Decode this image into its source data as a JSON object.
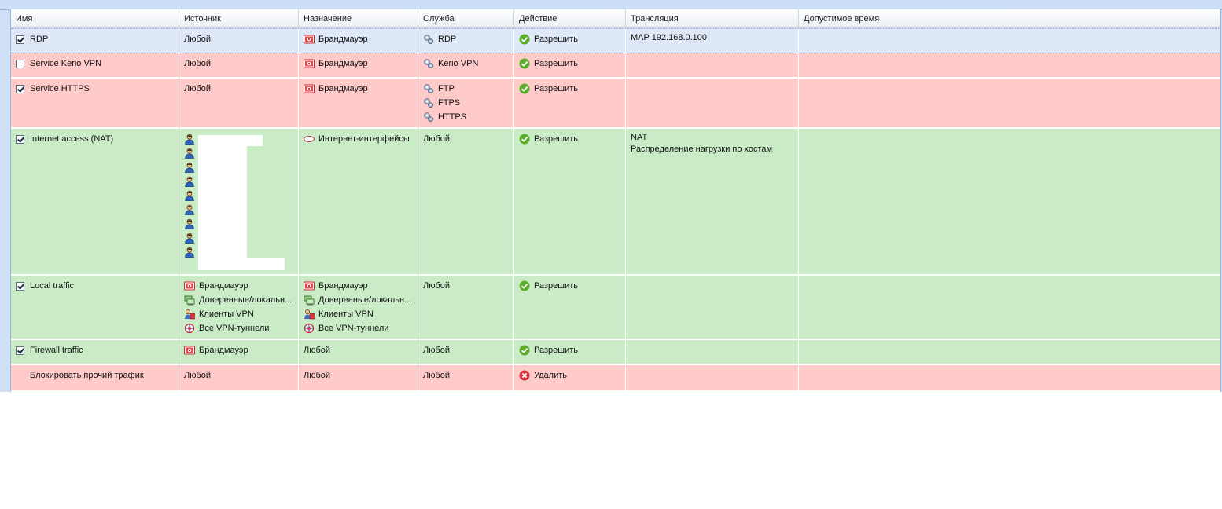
{
  "colors": {
    "selected_row": "#dfe8f6",
    "blocked_row": "#ffcaca",
    "allowed_row": "#c9ecc7",
    "allow_icon": "#5aac2a",
    "deny_icon": "#d9303a"
  },
  "columns": [
    {
      "label": "Имя"
    },
    {
      "label": "Источник"
    },
    {
      "label": "Назначение"
    },
    {
      "label": "Служба"
    },
    {
      "label": "Действие"
    },
    {
      "label": "Трансляция"
    },
    {
      "label": "Допустимое время"
    }
  ],
  "rows": [
    {
      "name": "RDP",
      "checkbox": "checked",
      "state": "selected",
      "source": [
        {
          "icon": "none",
          "text": "Любой"
        }
      ],
      "destination": [
        {
          "icon": "firewall-icon",
          "text": "Брандмауэр"
        }
      ],
      "service": [
        {
          "icon": "gears-icon",
          "text": "RDP"
        }
      ],
      "action": {
        "icon": "allow-icon",
        "text": "Разрешить"
      },
      "translation": [
        "MAP 192.168.0.100"
      ],
      "time": ""
    },
    {
      "name": "Service Kerio VPN",
      "checkbox": "unchecked",
      "state": "blocked",
      "source": [
        {
          "icon": "none",
          "text": "Любой"
        }
      ],
      "destination": [
        {
          "icon": "firewall-icon",
          "text": "Брандмауэр"
        }
      ],
      "service": [
        {
          "icon": "gears-icon",
          "text": "Kerio VPN"
        }
      ],
      "action": {
        "icon": "allow-icon",
        "text": "Разрешить"
      },
      "translation": [],
      "time": ""
    },
    {
      "name": "Service HTTPS",
      "checkbox": "checked",
      "state": "blocked",
      "source": [
        {
          "icon": "none",
          "text": "Любой"
        }
      ],
      "destination": [
        {
          "icon": "firewall-icon",
          "text": "Брандмауэр"
        }
      ],
      "service": [
        {
          "icon": "gears-icon",
          "text": "FTP"
        },
        {
          "icon": "gears-icon",
          "text": "FTPS"
        },
        {
          "icon": "gears-icon",
          "text": "HTTPS"
        }
      ],
      "action": {
        "icon": "allow-icon",
        "text": "Разрешить"
      },
      "translation": [],
      "time": ""
    },
    {
      "name": "Internet access (NAT)",
      "checkbox": "checked",
      "state": "allowed",
      "source": [
        {
          "icon": "user-icon",
          "text": ""
        },
        {
          "icon": "user-icon",
          "text": ""
        },
        {
          "icon": "user-icon",
          "text": ""
        },
        {
          "icon": "user-icon",
          "text": ""
        },
        {
          "icon": "user-icon",
          "text": ""
        },
        {
          "icon": "user-icon",
          "text": ""
        },
        {
          "icon": "user-icon",
          "text": ""
        },
        {
          "icon": "user-icon",
          "text": ""
        },
        {
          "icon": "user-icon",
          "text": ""
        }
      ],
      "destination": [
        {
          "icon": "interface-icon",
          "text": "Интернет-интерфейсы"
        }
      ],
      "service": [
        {
          "icon": "none",
          "text": "Любой"
        }
      ],
      "action": {
        "icon": "allow-icon",
        "text": "Разрешить"
      },
      "translation": [
        "NAT",
        "Распределение нагрузки по хостам"
      ],
      "time": ""
    },
    {
      "name": "Local traffic",
      "checkbox": "checked",
      "state": "allowed",
      "source": [
        {
          "icon": "firewall-icon",
          "text": "Брандмауэр"
        },
        {
          "icon": "network-icon",
          "text": "Доверенные/локальн..."
        },
        {
          "icon": "vpn-clients-icon",
          "text": "Клиенты VPN"
        },
        {
          "icon": "vpn-tunnels-icon",
          "text": "Все VPN-туннели"
        }
      ],
      "destination": [
        {
          "icon": "firewall-icon",
          "text": "Брандмауэр"
        },
        {
          "icon": "network-icon",
          "text": "Доверенные/локальн..."
        },
        {
          "icon": "vpn-clients-icon",
          "text": "Клиенты VPN"
        },
        {
          "icon": "vpn-tunnels-icon",
          "text": "Все VPN-туннели"
        }
      ],
      "service": [
        {
          "icon": "none",
          "text": "Любой"
        }
      ],
      "action": {
        "icon": "allow-icon",
        "text": "Разрешить"
      },
      "translation": [],
      "time": ""
    },
    {
      "name": "Firewall traffic",
      "checkbox": "checked",
      "state": "allowed",
      "source": [
        {
          "icon": "firewall-icon",
          "text": "Брандмауэр"
        }
      ],
      "destination": [
        {
          "icon": "none",
          "text": "Любой"
        }
      ],
      "service": [
        {
          "icon": "none",
          "text": "Любой"
        }
      ],
      "action": {
        "icon": "allow-icon",
        "text": "Разрешить"
      },
      "translation": [],
      "time": ""
    },
    {
      "name": "Блокировать прочий трафик",
      "checkbox": "none",
      "state": "blocked",
      "source": [
        {
          "icon": "none",
          "text": "Любой"
        }
      ],
      "destination": [
        {
          "icon": "none",
          "text": "Любой"
        }
      ],
      "service": [
        {
          "icon": "none",
          "text": "Любой"
        }
      ],
      "action": {
        "icon": "deny-icon",
        "text": "Удалить"
      },
      "translation": [],
      "time": ""
    }
  ]
}
